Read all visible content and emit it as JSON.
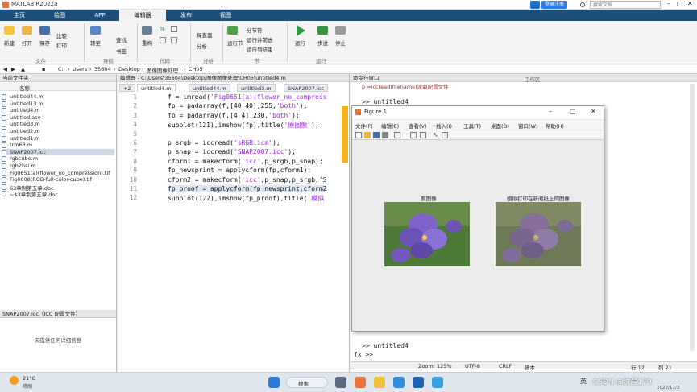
{
  "window": {
    "title": "MATLAB R2022a"
  },
  "titlebar": {
    "login_label": "登录注册",
    "search_placeholder": "搜索文档"
  },
  "ribbon": {
    "tabs": [
      "主页",
      "绘图",
      "APP",
      "编辑器",
      "发布",
      "视图"
    ],
    "active_tab": "编辑器",
    "buttons": {
      "new": "新建",
      "open": "打开",
      "save": "保存",
      "compare": "比较",
      "print": "打印",
      "goto": "转至",
      "find": "查找",
      "bookmark": "书签",
      "refactor": "重构",
      "debugger": "探查器",
      "analyze": "分析",
      "run_section": "运行节",
      "section_break": "分节符",
      "run_and_advance": "运行并前进",
      "run_to_end": "运行到结束",
      "run": "运行",
      "step": "步进",
      "stop": "停止"
    },
    "groups": {
      "file": "文件",
      "navigate": "导航",
      "code": "代码",
      "analyze": "分析",
      "section": "节",
      "run": "运行"
    }
  },
  "address": {
    "path": [
      "C:",
      "Users",
      "35604",
      "Desktop",
      "图像图像处理",
      "CH05"
    ]
  },
  "file_browser": {
    "header": "当前文件夹",
    "column_name": "名称",
    "files": [
      "untitled44.m",
      "untitled13.m",
      "untitled4.m",
      "untitled.asv",
      "untitled3.m",
      "untitled2.m",
      "untitled1.m",
      "trm63.m",
      "SNAP2007.icc",
      "rgbcube.m",
      "rgb2hsi.m",
      "Fig0651(a)(flower_no_compression).tif",
      "Fig0608(RGB-full-color-cube).tif",
      "63章制第五章.doc",
      "~$3章制第五章.doc"
    ],
    "selected_index": 8,
    "details_header": "SNAP2007.icc（ICC 配置文件）",
    "details_empty": "未提供任何详细信息"
  },
  "editor": {
    "header": "编辑器 - C:\\Users\\35604\\Desktop\\图像图像处理\\CH05\\untitled4.m",
    "tabs": [
      "+2",
      "untitled4.m",
      "untitled44.m",
      "untitled3.m",
      "SNAP2007.icc"
    ],
    "active_tab_index": 1,
    "line_numbers": [
      "1",
      "2",
      "3",
      "4",
      "5",
      "6",
      "7",
      "8",
      "9",
      "10",
      "11",
      "12"
    ],
    "lines": [
      [
        "f = imread(",
        "'Fig0651(a)(flower_no_compress",
        ""
      ],
      [
        "fp = padarray(f,[40 40],255,",
        "'both'",
        ");"
      ],
      [
        "fp = padarray(f,[4 4],230,",
        "'both'",
        ");"
      ],
      [
        "subplot(121),imshow(fp),title(",
        "'原图像'",
        ");"
      ],
      [
        "",
        "",
        ""
      ],
      [
        "p_srgb = iccread(",
        "'sRGB.icm'",
        ");"
      ],
      [
        "p_snap = iccread(",
        "'SNAP2007.icc'",
        ");"
      ],
      [
        "cform1 = makecform(",
        "'icc'",
        ",p_srgb,p_snap);"
      ],
      [
        "fp_newsprint = applycform(fp,cform1);",
        "",
        ""
      ],
      [
        "cform2 = makecform(",
        "'icc'",
        ",p_snap,p_srgb,'S"
      ],
      [
        "fp_proof = applycform(fp_newsprint,cform2",
        "",
        ""
      ],
      [
        "subplot(122),imshow(fp_proof),title(",
        "'模拟",
        ""
      ]
    ]
  },
  "command_window": {
    "header": "命令行窗口",
    "top_text": "p =iccread(filename)读取配置文件",
    "lines": [
      ">> untitled4",
      ">> untitled4"
    ],
    "prompt": "fx >>",
    "workspace_label": "工作区"
  },
  "figure": {
    "title": "Figure 1",
    "menu": [
      "文件(F)",
      "编辑(E)",
      "查看(V)",
      "插入(I)",
      "工具(T)",
      "桌面(D)",
      "窗口(W)",
      "帮助(H)"
    ],
    "subplot_titles": [
      "原图像",
      "模拟打印在新闻纸上的图像"
    ]
  },
  "status_bar": {
    "zoom": "Zoom: 125%",
    "encoding": "UTF-8",
    "eol": "CRLF",
    "type": "脚本",
    "row": "行 12",
    "col": "列 21"
  },
  "taskbar": {
    "weather_temp": "21°C",
    "weather_text": "晴朗",
    "search": "搜索",
    "ime": "英",
    "date": "2022/11/3",
    "watermark": "CSDN @沈晨179"
  },
  "colors": {
    "ribbon_blue": "#1e4f7a",
    "figure_bg": "#ececec",
    "flower_purple": "#7e62c8"
  }
}
